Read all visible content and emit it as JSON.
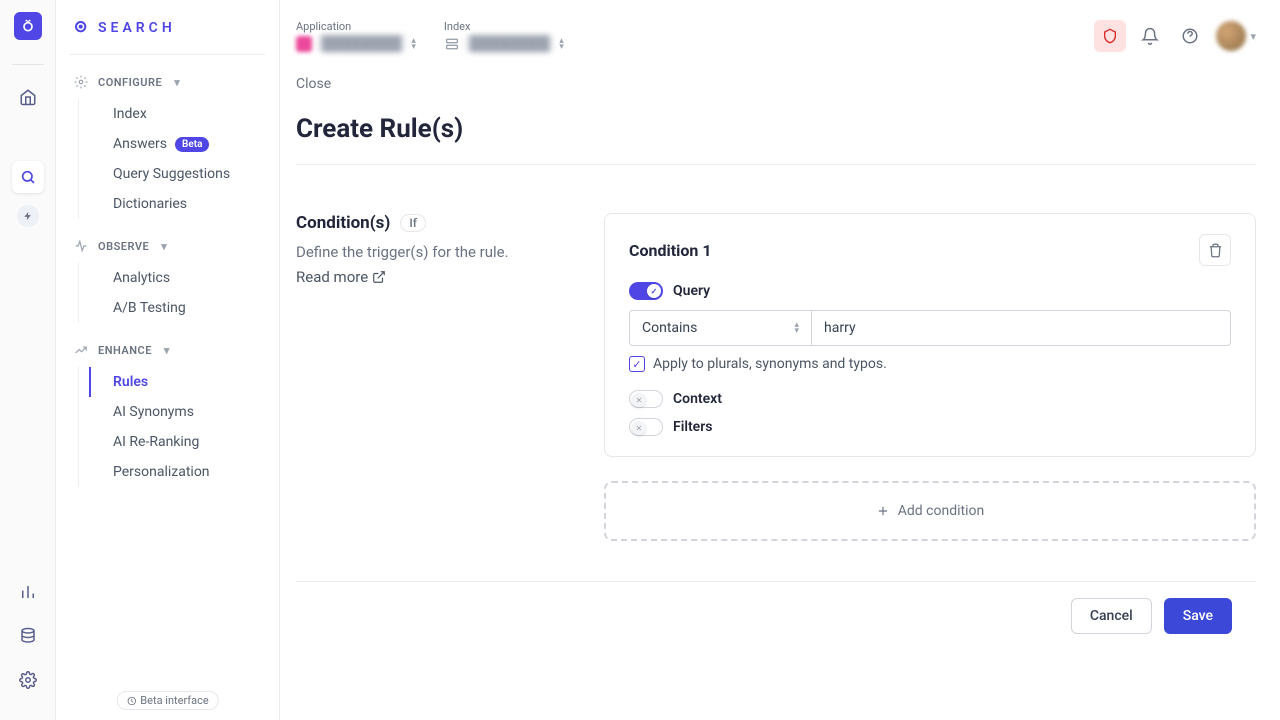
{
  "brand": "SEARCH",
  "topbar": {
    "application_label": "Application",
    "index_label": "Index"
  },
  "sidebar": {
    "sections": {
      "configure": {
        "title": "CONFIGURE",
        "items": [
          "Index",
          "Answers",
          "Query Suggestions",
          "Dictionaries"
        ],
        "beta_badge": "Beta"
      },
      "observe": {
        "title": "OBSERVE",
        "items": [
          "Analytics",
          "A/B Testing"
        ]
      },
      "enhance": {
        "title": "ENHANCE",
        "items": [
          "Rules",
          "AI Synonyms",
          "AI Re-Ranking",
          "Personalization"
        ]
      }
    },
    "beta_interface": "Beta interface"
  },
  "page": {
    "close": "Close",
    "title": "Create Rule(s)"
  },
  "conditions": {
    "heading": "Condition(s)",
    "if_pill": "If",
    "description": "Define the trigger(s) for the rule.",
    "read_more": "Read more",
    "card": {
      "title": "Condition 1",
      "query_label": "Query",
      "select_value": "Contains",
      "input_value": "harry",
      "apply_plurals": "Apply to plurals, synonyms and typos.",
      "context_label": "Context",
      "filters_label": "Filters"
    },
    "add_button": "Add condition"
  },
  "footer": {
    "cancel": "Cancel",
    "save": "Save"
  }
}
